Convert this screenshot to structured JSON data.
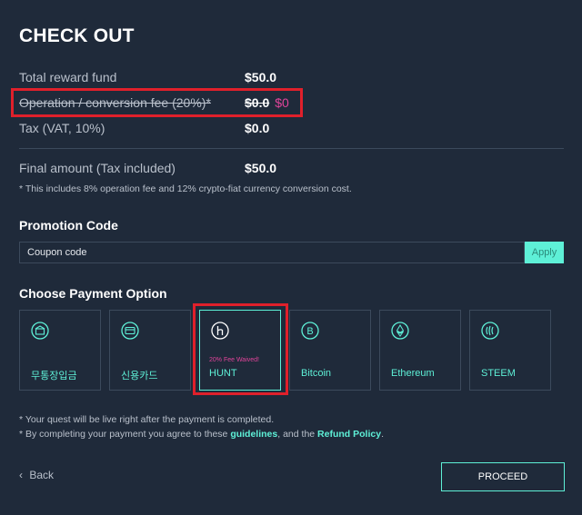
{
  "title": "CHECK OUT",
  "summary": {
    "total_label": "Total reward fund",
    "total_value": "$50.0",
    "fee_label": "Operation / conversion fee (20%)*",
    "fee_old_value": "$0.0",
    "fee_new_value": "$0",
    "tax_label": "Tax (VAT, 10%)",
    "tax_value": "$0.0",
    "final_label": "Final amount (Tax included)",
    "final_value": "$50.0",
    "note": "* This includes 8% operation fee and 12% crypto-fiat currency conversion cost."
  },
  "promotion": {
    "heading": "Promotion Code",
    "placeholder": "Coupon code",
    "apply_label": "Apply"
  },
  "payment": {
    "heading": "Choose Payment Option",
    "options": [
      {
        "label": "무통장입금",
        "icon": "bank-transfer-icon"
      },
      {
        "label": "신용카드",
        "icon": "credit-card-icon"
      },
      {
        "label": "HUNT",
        "icon": "hunt-icon",
        "badge": "20% Fee Waived!",
        "selected": true
      },
      {
        "label": "Bitcoin",
        "icon": "bitcoin-icon"
      },
      {
        "label": "Ethereum",
        "icon": "ethereum-icon"
      },
      {
        "label": "STEEM",
        "icon": "steem-icon"
      }
    ]
  },
  "footer": {
    "line1": "* Your quest will be live right after the payment is completed.",
    "line2_prefix": "* By completing your payment you agree to these ",
    "line2_link1": "guidelines",
    "line2_middle": ", and the ",
    "line2_link2": "Refund Policy",
    "line2_suffix": "."
  },
  "actions": {
    "back_label": "Back",
    "proceed_label": "PROCEED"
  },
  "colors": {
    "background": "#1f2a3a",
    "accent": "#5ef0d7",
    "pink": "#e0449a",
    "highlight_box": "#e0202b"
  }
}
